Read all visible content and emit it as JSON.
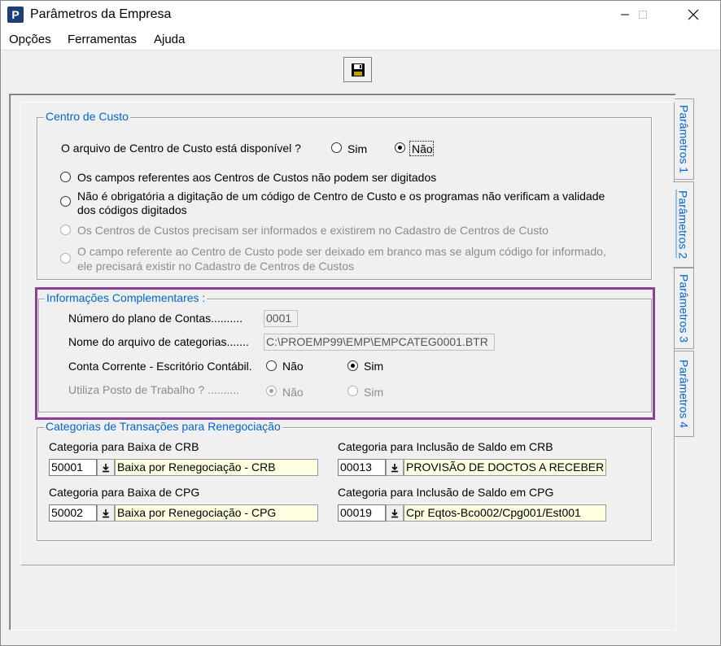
{
  "window": {
    "title": "Parâmetros da Empresa",
    "app_icon_letter": "P"
  },
  "menu": {
    "opcoes": "Opções",
    "ferramentas": "Ferramentas",
    "ajuda": "Ajuda"
  },
  "tabs": [
    {
      "label": "Parâmetros 1"
    },
    {
      "label": "Parâmetros 2"
    },
    {
      "label": "Parâmetros 3"
    },
    {
      "label": "Parâmetros 4"
    }
  ],
  "centro_custo": {
    "title": "Centro de Custo",
    "question": "O arquivo de  Centro de Custo  está disponível ?",
    "sim_label": "Sim",
    "nao_label": "Não",
    "selected": "Não",
    "options": [
      {
        "line1": "Os campos referentes aos Centros de Custos não podem ser digitados",
        "line2": ""
      },
      {
        "line1": "Não é obrigatória a digitação de um código de Centro de Custo e os programas não verificam a validade",
        "line2": "dos códigos digitados"
      },
      {
        "line1": "Os Centros de Custos precisam ser informados e existirem no Cadastro de Centros de Custo",
        "line2": ""
      },
      {
        "line1": "O campo referente ao Centro de Custo pode ser deixado em branco mas se algum código for informado,",
        "line2": "ele precisará existir no Cadastro de Centros de Custos"
      }
    ]
  },
  "info": {
    "title": "Informações Complementares :",
    "plano_label": "Número do plano de Contas..........",
    "plano_value": "0001",
    "arquivo_label": "Nome do arquivo de categorias.......",
    "arquivo_value": "C:\\PROEMP99\\EMP\\EMPCATEG0001.BTR",
    "conta_label": "Conta Corrente - Escritório Contábil.",
    "conta_nao": "Não",
    "conta_sim": "Sim",
    "conta_selected": "Sim",
    "posto_label": "Utiliza Posto de Trabalho ? ..........",
    "posto_nao": "Não",
    "posto_sim": "Sim",
    "posto_selected": "Não"
  },
  "categorias": {
    "title": "Categorias de Transações para Renegociação",
    "items": [
      {
        "label": "Categoria para Baixa de CRB",
        "code": "50001",
        "desc": "Baixa por Renegociação - CRB"
      },
      {
        "label": "Categoria para Inclusão de Saldo em CRB",
        "code": "00013",
        "desc": "PROVISÃO DE DOCTOS A RECEBER"
      },
      {
        "label": "Categoria para Baixa de CPG",
        "code": "50002",
        "desc": "Baixa por Renegociação - CPG"
      },
      {
        "label": "Categoria para Inclusão de Saldo em CPG",
        "code": "00019",
        "desc": "Cpr Eqtos-Bco002/Cpg001/Est001"
      }
    ]
  },
  "colors": {
    "accent": "#0066cc",
    "highlight_box": "#8e3e9c",
    "field_yellow": "#ffffe1"
  }
}
